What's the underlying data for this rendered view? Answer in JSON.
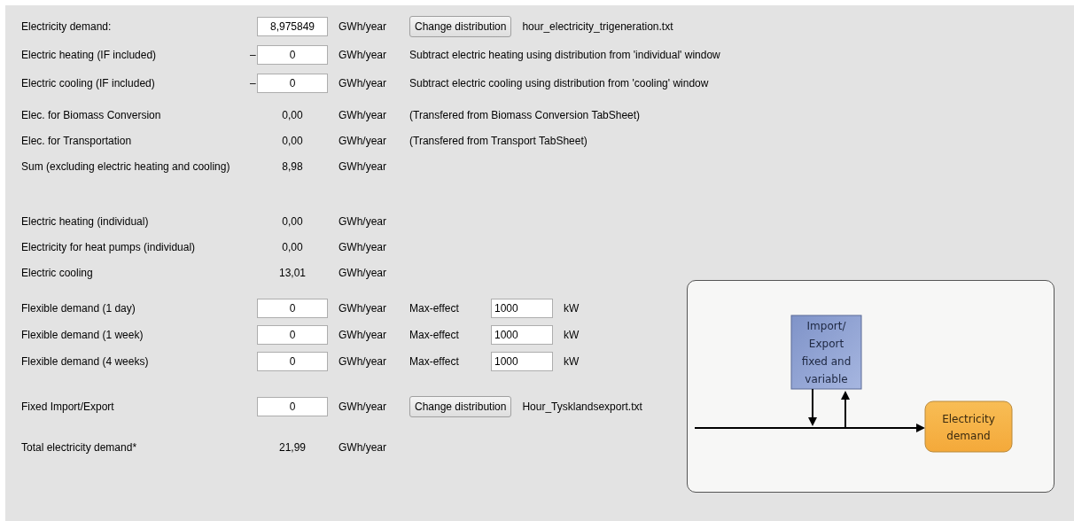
{
  "sections": [
    {
      "rows": [
        {
          "label": "Electricity demand:",
          "kind": "input",
          "value": "8,975849",
          "unit": "GWh/year",
          "extra": {
            "kind": "distribution",
            "button": "Change distribution",
            "file": "hour_electricity_trigeneration.txt"
          }
        },
        {
          "label": "Electric heating (IF included)",
          "prefix": "–",
          "kind": "input",
          "value": "0",
          "unit": "GWh/year",
          "extra": {
            "kind": "note",
            "text": "Subtract electric heating using distribution from 'individual' window"
          }
        },
        {
          "label": "Electric cooling (IF included)",
          "prefix": "–",
          "kind": "input",
          "value": "0",
          "unit": "GWh/year",
          "extra": {
            "kind": "note",
            "text": "Subtract electric cooling using distribution from 'cooling' window"
          }
        }
      ]
    },
    {
      "rows": [
        {
          "label": "Elec. for Biomass Conversion",
          "kind": "readout",
          "value": "0,00",
          "unit": "GWh/year",
          "extra": {
            "kind": "note",
            "text": "(Transfered from Biomass Conversion TabSheet)"
          }
        },
        {
          "label": "Elec. for Transportation",
          "kind": "readout",
          "value": "0,00",
          "unit": "GWh/year",
          "extra": {
            "kind": "note",
            "text": "(Transfered from Transport TabSheet)"
          }
        },
        {
          "label": "Sum (excluding electric heating and cooling)",
          "kind": "readout",
          "value": "8,98",
          "unit": "GWh/year"
        }
      ]
    },
    {
      "rows": [
        {
          "label": "Electric heating (individual)",
          "kind": "readout",
          "value": "0,00",
          "unit": "GWh/year"
        },
        {
          "label": "Electricity for heat pumps (individual)",
          "kind": "readout",
          "value": "0,00",
          "unit": "GWh/year"
        },
        {
          "label": "Electric cooling",
          "kind": "readout",
          "value": "13,01",
          "unit": "GWh/year"
        }
      ]
    },
    {
      "rows": [
        {
          "label": "Flexible demand (1 day)",
          "kind": "input",
          "value": "0",
          "unit": "GWh/year",
          "extra": {
            "kind": "max_effect",
            "label": "Max-effect",
            "value": "1000",
            "unit": "kW"
          }
        },
        {
          "label": "Flexible demand (1 week)",
          "kind": "input",
          "value": "0",
          "unit": "GWh/year",
          "extra": {
            "kind": "max_effect",
            "label": "Max-effect",
            "value": "1000",
            "unit": "kW"
          }
        },
        {
          "label": "Flexible demand (4 weeks)",
          "kind": "input",
          "value": "0",
          "unit": "GWh/year",
          "extra": {
            "kind": "max_effect",
            "label": "Max-effect",
            "value": "1000",
            "unit": "kW"
          }
        }
      ]
    },
    {
      "rows": [
        {
          "label": "Fixed Import/Export",
          "kind": "input",
          "value": "0",
          "unit": "GWh/year",
          "extra": {
            "kind": "distribution",
            "button": "Change distribution",
            "file": "Hour_Tysklandsexport.txt"
          }
        }
      ]
    },
    {
      "rows": [
        {
          "label": "Total electricity demand*",
          "kind": "readout",
          "value": "21,99",
          "unit": "GWh/year"
        }
      ]
    }
  ],
  "diagram": {
    "source_lines": [
      "Import/",
      "Export",
      "fixed and",
      "variable"
    ],
    "target_lines": [
      "Electricity",
      "demand"
    ]
  }
}
